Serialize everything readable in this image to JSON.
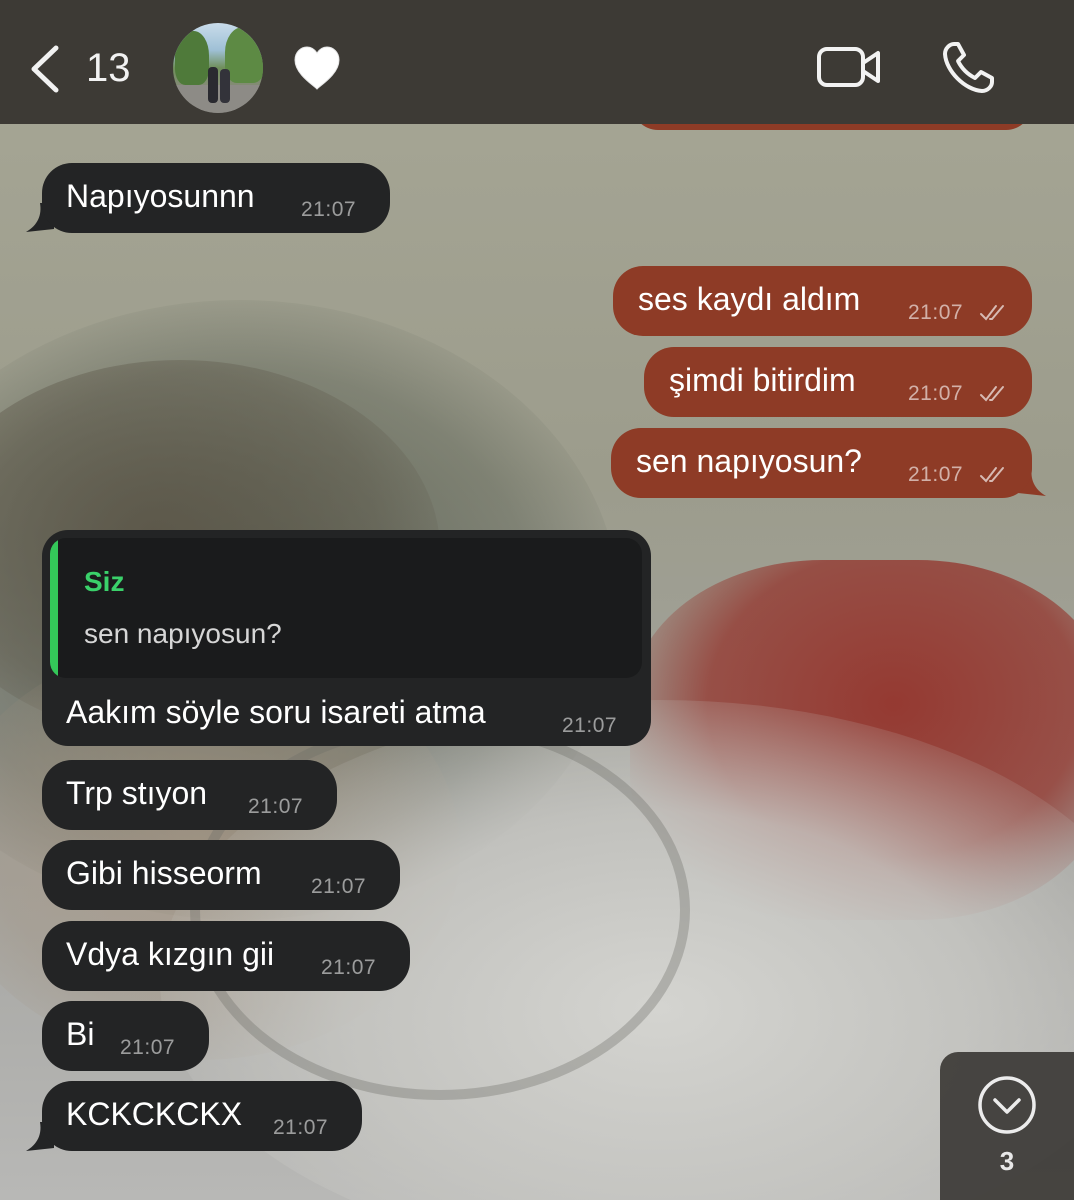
{
  "header": {
    "back_count": "13",
    "heart": "🤍",
    "icons": [
      "back-chevron-icon",
      "avatar",
      "heart-icon",
      "video-call-icon",
      "phone-call-icon"
    ]
  },
  "messages": [
    {
      "direction": "in",
      "text": "Napıyosunnn",
      "time": "21:07"
    },
    {
      "direction": "out",
      "text": "ses kaydı aldım",
      "time": "21:07",
      "status": "read"
    },
    {
      "direction": "out",
      "text": "şimdi bitirdim",
      "time": "21:07",
      "status": "read"
    },
    {
      "direction": "out",
      "text": "sen napıyosun?",
      "time": "21:07",
      "status": "read"
    },
    {
      "direction": "in",
      "reply": {
        "author": "Siz",
        "text": "sen napıyosun?"
      },
      "text": "Aakım söyle soru isareti atma",
      "time": "21:07"
    },
    {
      "direction": "in",
      "text": "Trp stıyon",
      "time": "21:07"
    },
    {
      "direction": "in",
      "text": "Gibi hisseorm",
      "time": "21:07"
    },
    {
      "direction": "in",
      "text": "Vdya kızgın gii",
      "time": "21:07"
    },
    {
      "direction": "in",
      "text": "Bi",
      "time": "21:07"
    },
    {
      "direction": "in",
      "text": "KCKCKCKX",
      "time": "21:07"
    }
  ],
  "scroll_down": {
    "unread_count": "3",
    "icon": "chevron-down-circle-icon"
  },
  "colors": {
    "header_bg": "#3d3a35",
    "incoming_bubble": "#232425",
    "outgoing_bubble": "#8e3b26",
    "reply_accent": "#34c759"
  }
}
